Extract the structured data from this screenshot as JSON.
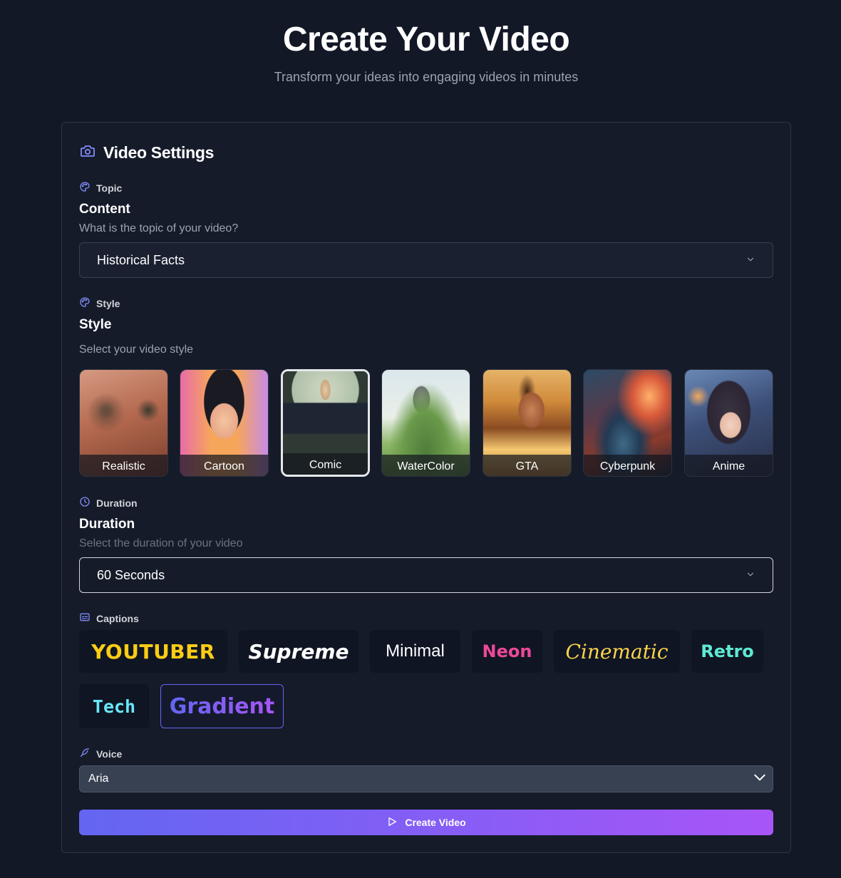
{
  "header": {
    "title": "Create Your Video",
    "subtitle": "Transform your ideas into engaging videos in minutes"
  },
  "card": {
    "title": "Video Settings",
    "icon": "camera-icon"
  },
  "topic": {
    "label": "Topic",
    "title": "Content",
    "description": "What is the topic of your video?",
    "selected": "Historical Facts"
  },
  "style": {
    "label": "Style",
    "title": "Style",
    "description": "Select your video style",
    "selected": "Comic",
    "options": [
      {
        "label": "Realistic"
      },
      {
        "label": "Cartoon"
      },
      {
        "label": "Comic"
      },
      {
        "label": "WaterColor"
      },
      {
        "label": "GTA"
      },
      {
        "label": "Cyberpunk"
      },
      {
        "label": "Anime"
      }
    ]
  },
  "duration": {
    "label": "Duration",
    "title": "Duration",
    "description": "Select the duration of your video",
    "selected": "60 Seconds"
  },
  "captions": {
    "label": "Captions",
    "selected": "Gradient",
    "options": [
      {
        "label": "YOUTUBER",
        "color": "#facc15"
      },
      {
        "label": "Supreme",
        "color": "#ffffff"
      },
      {
        "label": "Minimal",
        "color": "#ffffff"
      },
      {
        "label": "Neon",
        "color": "#ec4899"
      },
      {
        "label": "Cinematic",
        "color": "#fcd34d"
      },
      {
        "label": "Retro",
        "color": "#5eead4"
      },
      {
        "label": "Tech",
        "color": "#67e8f9"
      },
      {
        "label": "Gradient",
        "color": "#8b5cf6"
      }
    ]
  },
  "voice": {
    "label": "Voice",
    "selected": "Aria"
  },
  "actions": {
    "create_label": "Create Video"
  },
  "colors": {
    "background": "#121826",
    "accent_start": "#6366f1",
    "accent_end": "#a855f7",
    "border": "#2e3545"
  }
}
